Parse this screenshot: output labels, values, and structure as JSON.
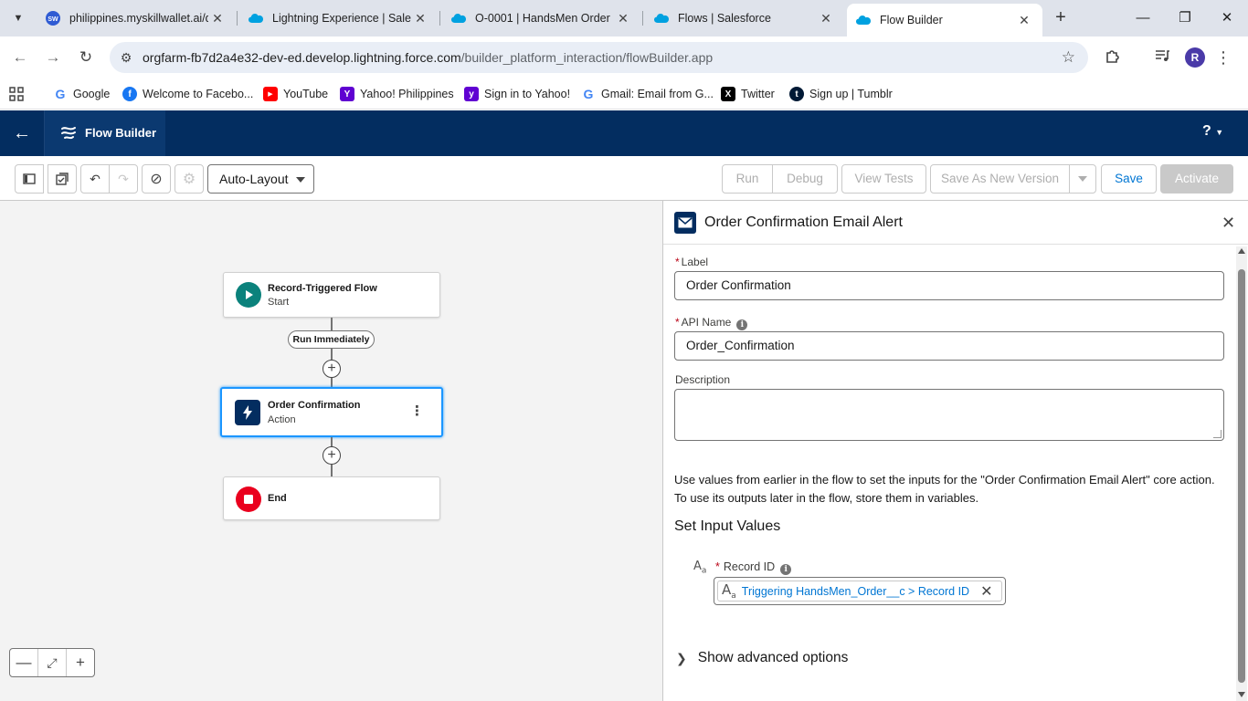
{
  "browser": {
    "tabs": [
      {
        "title": "philippines.myskillwallet.ai/d",
        "favicon": "sw-icon"
      },
      {
        "title": "Lightning Experience | Salesf",
        "favicon": "salesforce-cloud-icon"
      },
      {
        "title": "O-0001 | HandsMen Order |",
        "favicon": "salesforce-cloud-icon"
      },
      {
        "title": "Flows | Salesforce",
        "favicon": "salesforce-cloud-icon"
      },
      {
        "title": "Flow Builder",
        "favicon": "salesforce-cloud-icon"
      }
    ],
    "url_host": "orgfarm-fb7d2a4e32-dev-ed.develop.lightning.force.com",
    "url_path": "/builder_platform_interaction/flowBuilder.app",
    "profile_initial": "R",
    "bookmarks": [
      {
        "label": "Google"
      },
      {
        "label": "Welcome to Facebo..."
      },
      {
        "label": "YouTube"
      },
      {
        "label": "Yahoo! Philippines"
      },
      {
        "label": "Sign in to Yahoo!"
      },
      {
        "label": "Gmail: Email from G..."
      },
      {
        "label": "Twitter"
      },
      {
        "label": "Sign up | Tumblr"
      }
    ]
  },
  "app": {
    "title": "Flow Builder",
    "help": "?"
  },
  "toolbar": {
    "layout_select": "Auto-Layout",
    "run": "Run",
    "debug": "Debug",
    "view_tests": "View Tests",
    "save_as_new": "Save As New Version",
    "save": "Save",
    "activate": "Activate"
  },
  "canvas": {
    "start_node": {
      "title": "Record-Triggered Flow",
      "subtitle": "Start"
    },
    "run_pill": "Run Immediately",
    "action_node": {
      "title": "Order Confirmation",
      "subtitle": "Action"
    },
    "end_node": {
      "title": "End"
    }
  },
  "panel": {
    "title": "Order Confirmation Email Alert",
    "label_field": {
      "label": "Label",
      "value": "Order Confirmation"
    },
    "api_field": {
      "label": "API Name",
      "value": "Order_Confirmation"
    },
    "description_field": {
      "label": "Description",
      "value": ""
    },
    "help_text": "Use values from earlier in the flow to set the inputs for the \"Order Confirmation Email Alert\" core action. To use its outputs later in the flow, store them in variables.",
    "section_title": "Set Input Values",
    "record_id": {
      "label": "Record ID",
      "value": "Triggering HandsMen_Order__c > Record ID"
    },
    "advanced": "Show advanced options"
  },
  "colors": {
    "header_navy": "#032d60",
    "brand_blue": "#0176d3",
    "start_teal": "#0b827c",
    "end_red": "#ea001e",
    "selection_blue": "#1b96ff"
  }
}
